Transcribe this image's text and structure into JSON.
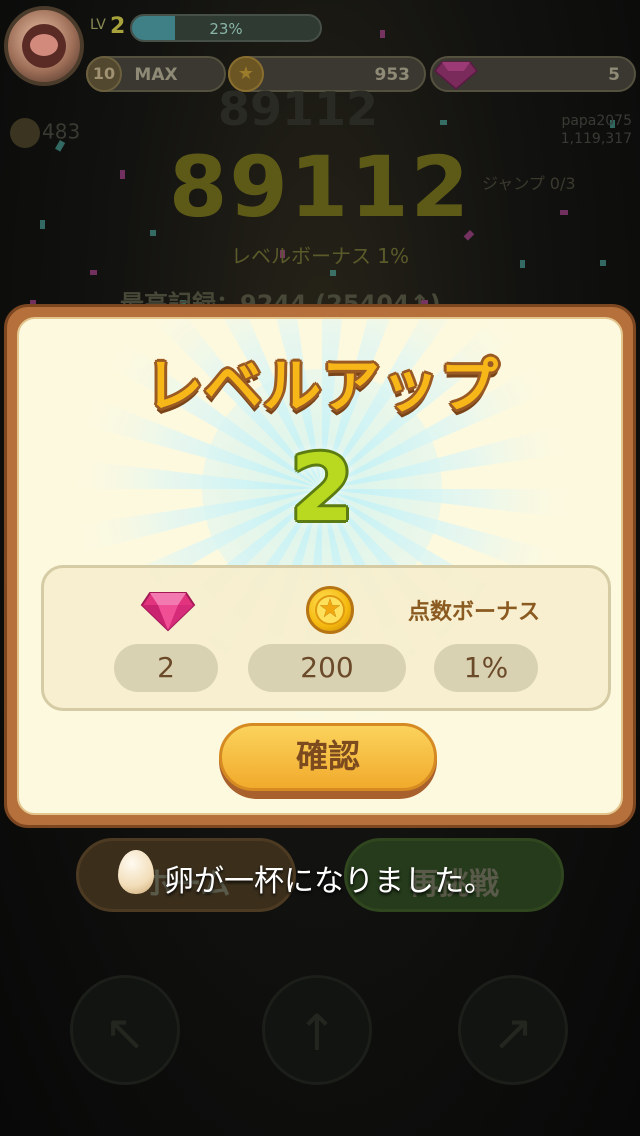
{
  "hud": {
    "lv_label": "LV",
    "level": "2",
    "xp_text": "23%",
    "xp_fraction": 0.23,
    "badge_number": "10",
    "badge_text": "MAX",
    "coins": "953",
    "gems": "5"
  },
  "background": {
    "ghost_score": "89112",
    "score": "89112",
    "level_bonus": "レベルボーナス 1%",
    "best_record": "最高記録：9244 (25404↑)",
    "left_counter": "483",
    "user_name": "papa2075",
    "user_stat": "1,119,317",
    "right_box_text": "ジャンプ 0/3",
    "home_button": "ホーム",
    "retry_button": "再挑戦"
  },
  "dialog": {
    "title": "レベルアップ",
    "new_level": "2",
    "bonus_label": "点数ボーナス",
    "gem_reward": "2",
    "coin_reward": "200",
    "score_bonus": "1%",
    "confirm_label": "確認"
  },
  "toast": {
    "message": "卵が一杯になりました。"
  },
  "colors": {
    "title": "#f7b719",
    "level_number": "#b9d920",
    "confirm_button": "#f1aa2c",
    "dialog_frame": "#b5703c"
  },
  "icons": {
    "gem": "pink-diamond-icon",
    "coin": "gold-star-coin-icon",
    "egg": "egg-icon"
  }
}
